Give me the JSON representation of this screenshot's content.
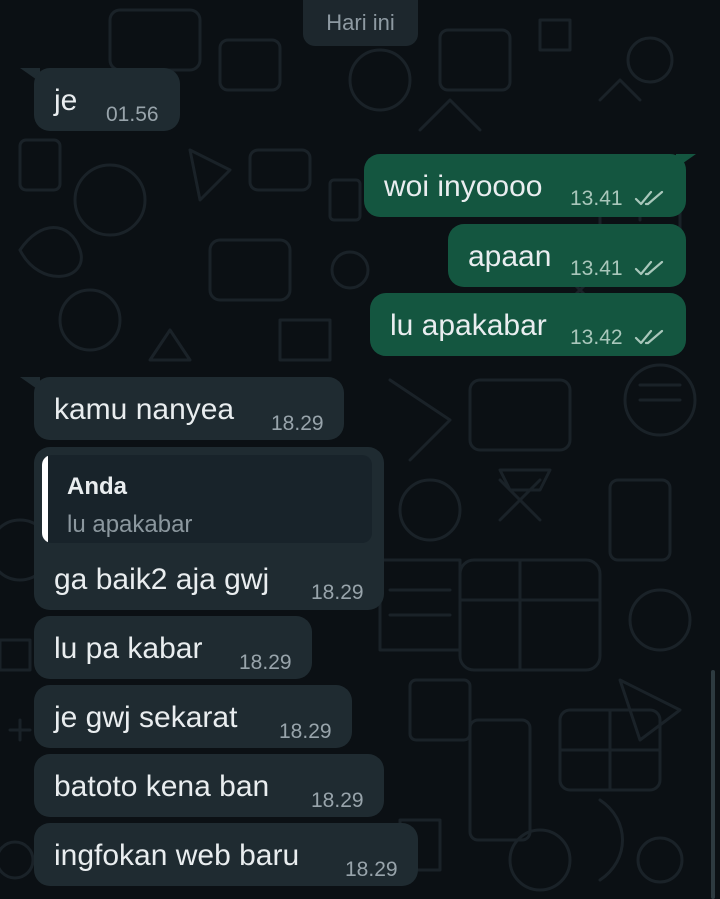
{
  "chat": {
    "date_label": "Hari ini",
    "messages": [
      {
        "direction": "incoming",
        "text": "je",
        "time": "01.56"
      },
      {
        "direction": "outgoing",
        "text": "woi inyoooo",
        "time": "13.41",
        "status": "read"
      },
      {
        "direction": "outgoing",
        "text": "apaan",
        "time": "13.41",
        "status": "read"
      },
      {
        "direction": "outgoing",
        "text": "lu apakabar",
        "time": "13.42",
        "status": "read"
      },
      {
        "direction": "incoming",
        "text": "kamu nanyea",
        "time": "18.29"
      },
      {
        "direction": "incoming",
        "text": "ga baik2 aja gwj",
        "time": "18.29",
        "reply_to": {
          "sender": "Anda",
          "text": "lu apakabar"
        }
      },
      {
        "direction": "incoming",
        "text": "lu pa kabar",
        "time": "18.29"
      },
      {
        "direction": "incoming",
        "text": "je gwj sekarat",
        "time": "18.29"
      },
      {
        "direction": "incoming",
        "text": "batoto kena ban",
        "time": "18.29"
      },
      {
        "direction": "incoming",
        "text": "ingfokan web baru",
        "time": "18.29"
      }
    ]
  },
  "icons": {
    "read_receipt": "double-check-icon",
    "wallpaper": "doodle-pattern"
  },
  "colors": {
    "background": "#0b1014",
    "incoming_bubble": "#1f2b31",
    "outgoing_bubble": "#145640",
    "read_tick": "#a9c7bb",
    "quote_bar": "#ffffff"
  }
}
